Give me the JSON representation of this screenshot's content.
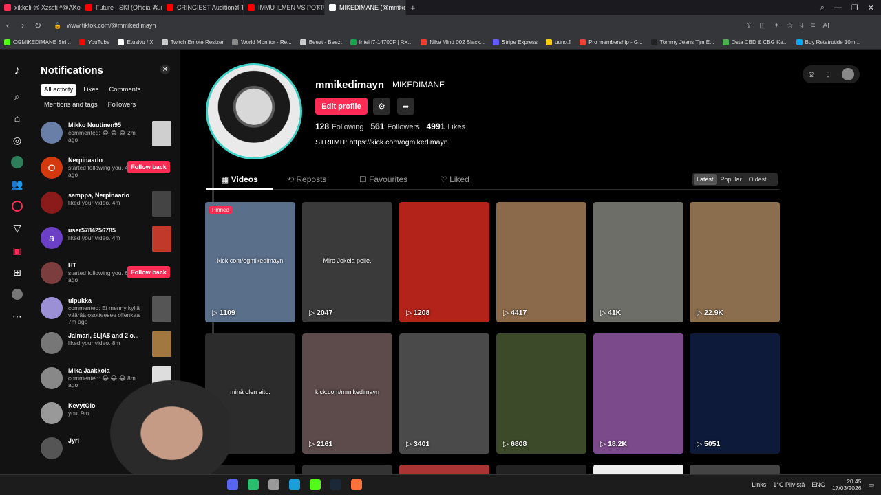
{
  "browser": {
    "tabs": [
      {
        "label": "xikkeli 😢 Xzssti ^@AKottt",
        "color": "#ff2d55",
        "active": false
      },
      {
        "label": "Future - SKI (Official Audio)",
        "color": "#ff0000",
        "active": false
      },
      {
        "label": "CRINGIEST Auditions! Try",
        "color": "#ff0000",
        "active": false
      },
      {
        "label": "IMMU ILMEN VS POTTUKI",
        "color": "#ff0000",
        "active": false
      },
      {
        "label": "MIKEDIMANE (@mmikedi",
        "color": "#ffffff",
        "active": true
      }
    ],
    "new_tab": "+",
    "url": "www.tiktok.com/@mmikedimayn",
    "ai_label": "AI",
    "bookmarks": [
      {
        "label": "OGMIKEDIMANE Stri...",
        "color": "#53fc18"
      },
      {
        "label": "YouTube",
        "color": "#ff0000"
      },
      {
        "label": "Etusivu / X",
        "color": "#ffffff"
      },
      {
        "label": "Twitch Emote Resizer",
        "color": "#cccccc"
      },
      {
        "label": "World Monitor - Re...",
        "color": "#888888"
      },
      {
        "label": "Beezt - Beezt",
        "color": "#cccccc"
      },
      {
        "label": "Intel i7-14700F | RX...",
        "color": "#1aa34a"
      },
      {
        "label": "Nike Mind 002 Black...",
        "color": "#ff3b30"
      },
      {
        "label": "Stripe Express",
        "color": "#635bff"
      },
      {
        "label": "uuno.fi",
        "color": "#ffcc00"
      },
      {
        "label": "Pro membership - G...",
        "color": "#ea4335"
      },
      {
        "label": "Tommy Jeans Tjm E...",
        "color": "#222222"
      },
      {
        "label": "Osta CBD & CBG Ke...",
        "color": "#4caf50"
      },
      {
        "label": "Buy Retatrutide 10m...",
        "color": "#03a9f4"
      }
    ]
  },
  "notifications": {
    "title": "Notifications",
    "filters": [
      "All activity",
      "Likes",
      "Comments",
      "Mentions and tags",
      "Followers"
    ],
    "items": [
      {
        "name": "Mikko Nuutinen95",
        "text": "commented: 😂 😂 😂 2m ago",
        "avatar": "#6a7fa8",
        "thumb": "#cfcfcf",
        "follow": ""
      },
      {
        "name": "Nerpinaario",
        "text": "started following you. 4m ago",
        "avatar": "#d4380d",
        "thumb": "",
        "follow": "Follow back",
        "initial": "O"
      },
      {
        "name": "samppa, Nerpinaario",
        "text": "liked your video. 4m",
        "avatar": "#8b1a1a",
        "thumb": "#444",
        "follow": ""
      },
      {
        "name": "user5784256785",
        "text": "liked your video. 4m",
        "avatar": "#6c3fc7",
        "thumb": "#c0392b",
        "follow": "",
        "initial": "a"
      },
      {
        "name": "HT",
        "text": "started following you. 6m ago",
        "avatar": "#7b3d3d",
        "thumb": "",
        "follow": "Follow back"
      },
      {
        "name": "ulpukka",
        "text": "commented: Ei menny kyllä väärää osotteesee ollenkaa 7m ago",
        "avatar": "#9b8fd6",
        "thumb": "#555",
        "follow": ""
      },
      {
        "name": "Jalmari, £L|A$ and 2 o...",
        "text": "liked your video. 8m",
        "avatar": "#777",
        "thumb": "#a07840",
        "follow": ""
      },
      {
        "name": "Mika Jaakkola",
        "text": "commented: 😂 😂 😂 8m ago",
        "avatar": "#888",
        "thumb": "#ddd",
        "follow": ""
      },
      {
        "name": "KevytOlo",
        "text": "you. 9m",
        "avatar": "#999",
        "thumb": "",
        "follow": ""
      },
      {
        "name": "Jyri",
        "text": "",
        "avatar": "#555",
        "thumb": "",
        "follow": ""
      }
    ]
  },
  "profile": {
    "username": "mmikedimayn",
    "nickname": "MIKEDIMANE",
    "edit_label": "Edit profile",
    "following": "128",
    "following_label": "Following",
    "followers": "561",
    "followers_label": "Followers",
    "likes": "4991",
    "likes_label": "Likes",
    "bio": "STRIIMIT: https://kick.com/ogmikedimayn",
    "tabs": [
      "Videos",
      "Reposts",
      "Favourites",
      "Liked"
    ],
    "sort": [
      "Latest",
      "Popular",
      "Oldest"
    ],
    "pinned_label": "Pinned"
  },
  "videos": [
    {
      "count": "▷ 1109",
      "caption": "kick.com/ogmikedimayn",
      "bg": "#5a6f8a",
      "pinned": true
    },
    {
      "count": "▷ 2047",
      "caption": "Miro Jokela pelle.",
      "bg": "#3a3a3a"
    },
    {
      "count": "▷ 1208",
      "caption": "",
      "bg": "#b3231a"
    },
    {
      "count": "▷ 4417",
      "caption": "",
      "bg": "#8a6a4a"
    },
    {
      "count": "▷ 41K",
      "caption": "",
      "bg": "#6e6e68"
    },
    {
      "count": "▷ 22.9K",
      "caption": "",
      "bg": "#8a6e4e"
    },
    {
      "count": "",
      "caption": "minä olen aito.",
      "bg": "#2c2c2c"
    },
    {
      "count": "▷ 2161",
      "caption": "kick.com/mmikedimayn",
      "bg": "#5d4a4a"
    },
    {
      "count": "▷ 3401",
      "caption": "",
      "bg": "#4a4a4a"
    },
    {
      "count": "▷ 6808",
      "caption": "",
      "bg": "#3c4a2a"
    },
    {
      "count": "▷ 18.2K",
      "caption": "",
      "bg": "#7a4a8a"
    },
    {
      "count": "▷ 5051",
      "caption": "",
      "bg": "#0d1a3a"
    }
  ],
  "taskbar": {
    "links": "Links",
    "weather": "1°C Pilvistä",
    "lang": "ENG",
    "time": "20.45",
    "date": "17/03/2026"
  }
}
